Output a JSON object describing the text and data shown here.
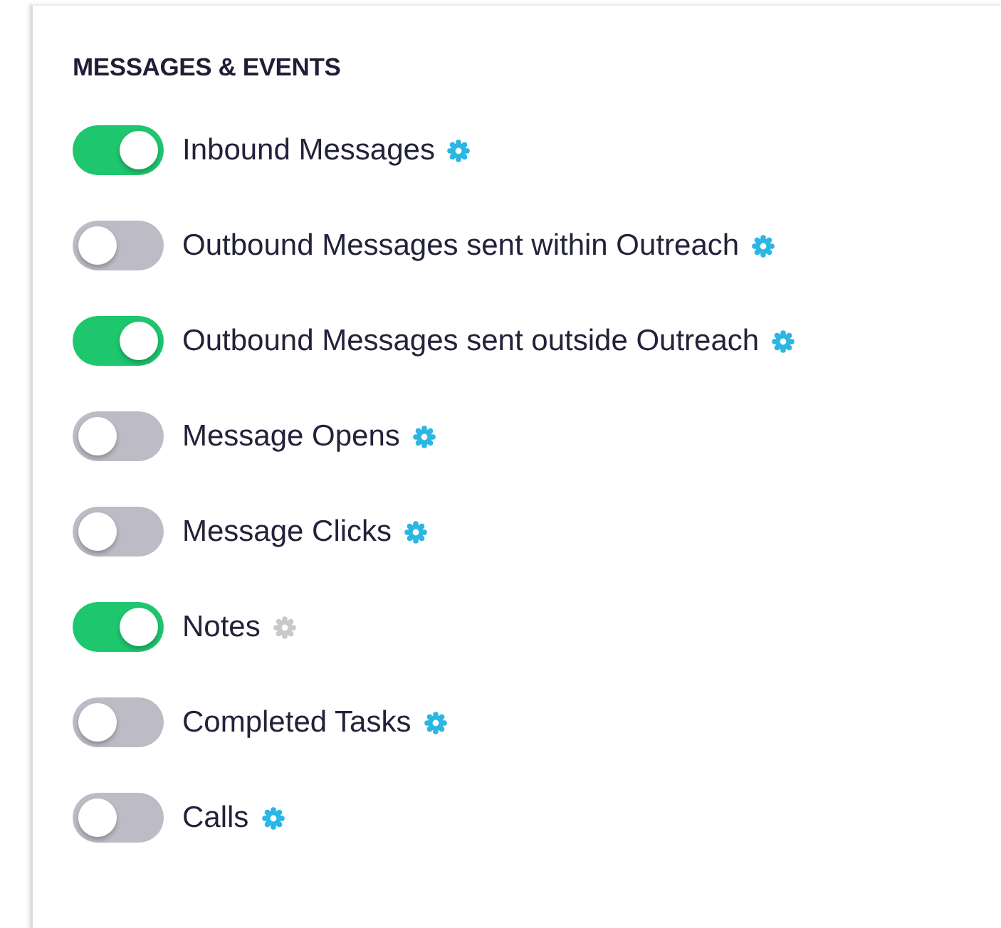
{
  "section": {
    "title": "MESSAGES & EVENTS"
  },
  "settings": [
    {
      "label": "Inbound Messages",
      "on": true,
      "settings_disabled": false
    },
    {
      "label": "Outbound Messages sent within Outreach",
      "on": false,
      "settings_disabled": false
    },
    {
      "label": "Outbound Messages sent outside Outreach",
      "on": true,
      "settings_disabled": false
    },
    {
      "label": "Message Opens",
      "on": false,
      "settings_disabled": false
    },
    {
      "label": "Message Clicks",
      "on": false,
      "settings_disabled": false
    },
    {
      "label": "Notes",
      "on": true,
      "settings_disabled": true
    },
    {
      "label": "Completed Tasks",
      "on": false,
      "settings_disabled": false
    },
    {
      "label": "Calls",
      "on": false,
      "settings_disabled": false
    }
  ]
}
